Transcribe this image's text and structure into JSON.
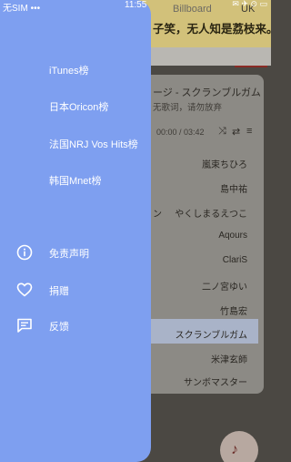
{
  "status_bar": {
    "carrier": "无SIM",
    "signal_dots": "•••",
    "time": "11:55",
    "right_icons": "✉ ✈ ⊙ ▭"
  },
  "background": {
    "banner_text": "子笑，无人知是荔枝来。",
    "tabs": [
      "Billboard",
      "UK"
    ],
    "now_playing_title": "ージ - スクランブルガム",
    "now_playing_sub": "无歌词，请勿放弃",
    "time": "00:00 / 03:42",
    "controls": [
      "⤨",
      "⇄",
      "≡"
    ],
    "artists": [
      "嵐束ちひろ",
      "島中祐",
      "やくしまるえつこ",
      "Aqours",
      "ClariS",
      "二ノ宮ゆい",
      "竹島宏",
      "スクランブルガム",
      "米津玄師",
      "サンボマスター"
    ],
    "left_fragment": "ン",
    "fab_icon": "♪"
  },
  "drawer": {
    "charts": [
      "iTunes榜",
      "日本Oricon榜",
      "法国NRJ Vos Hits榜",
      "韩国Mnet榜"
    ],
    "menu": [
      {
        "label": "免责声明",
        "icon": "info-icon"
      },
      {
        "label": "捐赠",
        "icon": "heart-icon"
      },
      {
        "label": "反馈",
        "icon": "feedback-icon"
      }
    ]
  }
}
